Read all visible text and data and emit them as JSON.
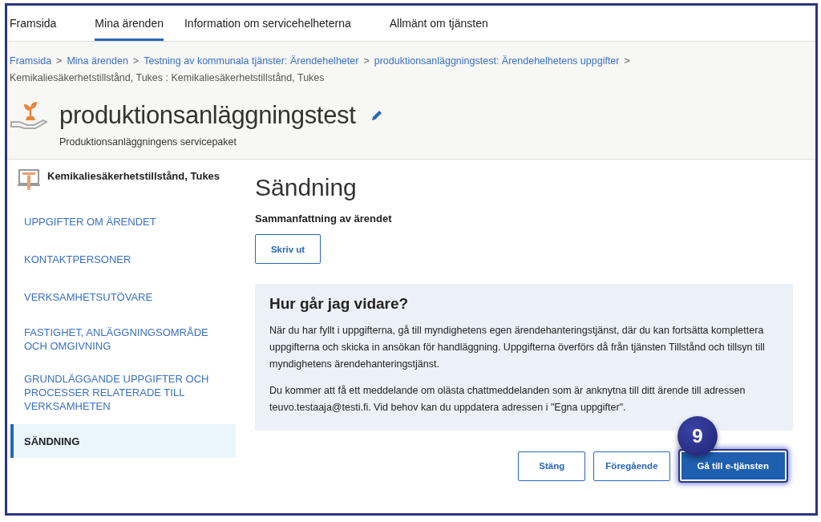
{
  "tabs": [
    {
      "label": "Framsida",
      "selected": false
    },
    {
      "label": "Mina ärenden",
      "selected": true
    },
    {
      "label": "Information om servicehelheterna",
      "selected": false
    },
    {
      "label": "Allmänt om tjänsten",
      "selected": false
    }
  ],
  "breadcrumb": [
    {
      "label": "Framsida",
      "kind": "link",
      "separator": ">"
    },
    {
      "label": "Mina ärenden",
      "kind": "link",
      "separator": ">"
    },
    {
      "label": "Testning av kommunala tjänster: Ärendehelheter",
      "kind": "link",
      "separator": ">"
    },
    {
      "label": "produktionsanläggningstest: Ärendehelhetens uppgifter",
      "kind": "link",
      "separator": ">"
    },
    {
      "label": "Kemikaliesäkerhetstillstånd, Tukes : Kemikaliesäkerhetstillstånd, Tukes",
      "kind": "current"
    }
  ],
  "header": {
    "title": "produktionsanläggningstest",
    "subtitle": "Produktionsanläggningens servicepaket"
  },
  "sidebar": {
    "title": "Kemikaliesäkerhetstillstånd, Tukes",
    "items": [
      {
        "label": "UPPGIFTER OM ÄRENDET",
        "selected": false
      },
      {
        "label": "KONTAKTPERSONER",
        "selected": false
      },
      {
        "label": "VERKSAMHETSUTÖVARE",
        "selected": false
      },
      {
        "label": "FASTIGHET, ANLÄGGNINGSOMRÅDE OCH OMGIVNING",
        "selected": false
      },
      {
        "label": "GRUNDLÄGGANDE UPPGIFTER OCH PROCESSER RELATERADE TILL VERKSAMHETEN",
        "selected": false
      },
      {
        "label": "SÄNDNING",
        "selected": true
      }
    ]
  },
  "main": {
    "title": "Sändning",
    "summary_heading": "Sammanfattning av ärendet",
    "print_button": "Skriv ut",
    "info": {
      "title": "Hur går jag vidare?",
      "paragraphs": [
        "När du har fyllt i uppgifterna, gå till myndighetens egen ärendehanteringstjänst, där du kan fortsätta komplettera uppgifterna och skicka in ansökan för handläggning. Uppgifterna överförs då från tjänsten Tillstånd och tillsyn till myndighetens ärendehanteringstjänst.",
        "Du kommer att få ett meddelande om olästa chattmeddelanden som är anknytna till ditt ärende till adressen teuvo.testaaja@testi.fi. Vid behov kan du uppdatera adressen i \"Egna uppgifter\"."
      ]
    },
    "buttons": [
      {
        "label": "Stäng",
        "kind": "secondary"
      },
      {
        "label": "Föregående",
        "kind": "secondary"
      },
      {
        "label": "Gå till e-tjänsten",
        "kind": "primary"
      }
    ],
    "step_badge": "9"
  }
}
